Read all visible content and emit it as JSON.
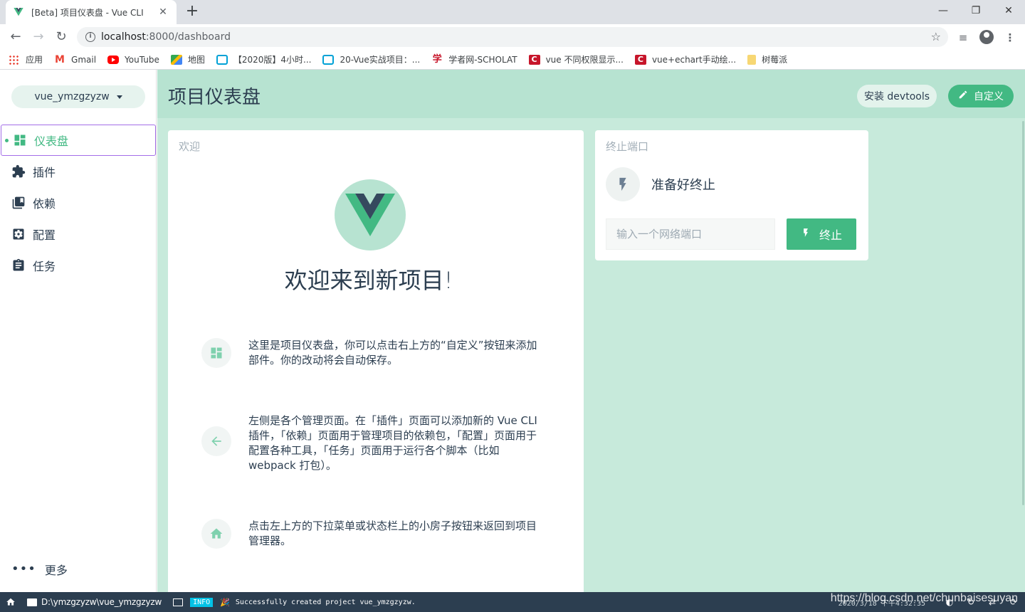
{
  "browser": {
    "tab_title": "[Beta] 项目仪表盘 - Vue CLI",
    "url_host": "localhost",
    "url_rest": ":8000/dashboard",
    "bookmarks": [
      {
        "label": "应用",
        "icon": "apps-grid-icon",
        "color": "#e94235"
      },
      {
        "label": "Gmail",
        "icon": "gmail-icon",
        "color": "#ea4335"
      },
      {
        "label": "YouTube",
        "icon": "youtube-icon",
        "color": "#ff0000"
      },
      {
        "label": "地图",
        "icon": "maps-icon",
        "color": "#34a853"
      },
      {
        "label": "【2020版】4小时...",
        "icon": "bilibili-icon",
        "color": "#00a1d6"
      },
      {
        "label": "20-Vue实战项目：...",
        "icon": "bilibili-icon",
        "color": "#00a1d6"
      },
      {
        "label": "学者网-SCHOLAT",
        "icon": "scholat-icon",
        "color": "#c7162b"
      },
      {
        "label": "vue 不同权限显示...",
        "icon": "csdn-icon",
        "color": "#c7162b"
      },
      {
        "label": "vue+echart手动绘...",
        "icon": "csdn-icon",
        "color": "#c7162b"
      },
      {
        "label": "树莓派",
        "icon": "folder-icon",
        "color": "#f7d774"
      }
    ]
  },
  "sidebar": {
    "project_name": "vue_ymzgzyzw",
    "items": [
      {
        "label": "仪表盘",
        "icon": "dashboard-icon",
        "active": true
      },
      {
        "label": "插件",
        "icon": "puzzle-icon",
        "active": false
      },
      {
        "label": "依赖",
        "icon": "library-icon",
        "active": false
      },
      {
        "label": "配置",
        "icon": "settings-icon",
        "active": false
      },
      {
        "label": "任务",
        "icon": "assignment-icon",
        "active": false
      }
    ],
    "more_label": "更多"
  },
  "header": {
    "title": "项目仪表盘",
    "devtools_label": "安装 devtools",
    "customize_label": "自定义"
  },
  "welcome": {
    "card_title": "欢迎",
    "heading": "欢迎来到新项目!",
    "tips": [
      {
        "icon": "dashboard-icon",
        "text": "这里是项目仪表盘，你可以点击右上方的“自定义”按钮来添加部件。你的改动将会自动保存。"
      },
      {
        "icon": "arrow-left-icon",
        "text": "左侧是各个管理页面。在「插件」页面可以添加新的 Vue CLI 插件，「依赖」页面用于管理项目的依赖包，「配置」页面用于配置各种工具，「任务」页面用于运行各个脚本（比如 webpack 打包）。"
      },
      {
        "icon": "home-icon",
        "text": "点击左上方的下拉菜单或状态栏上的小房子按钮来返回到项目管理器。"
      }
    ]
  },
  "terminate": {
    "card_title": "终止端口",
    "status": "准备好终止",
    "input_placeholder": "输入一个网络端口",
    "button_label": "终止"
  },
  "statusbar": {
    "path": "D:\\ymzgzyzw\\vue_ymzgzyzw",
    "log_level": "INFO",
    "log_message": "Successfully created project vue_ymzgzyzw.",
    "time": "2020/3/18 下午4:32:35"
  },
  "watermark": "https://blog.csdn.net/chunbaisesuyan",
  "colors": {
    "accent": "#42b983",
    "header_bg": "#b7e3d1",
    "main_bg": "#c7eadb",
    "dark": "#2c3e50"
  }
}
